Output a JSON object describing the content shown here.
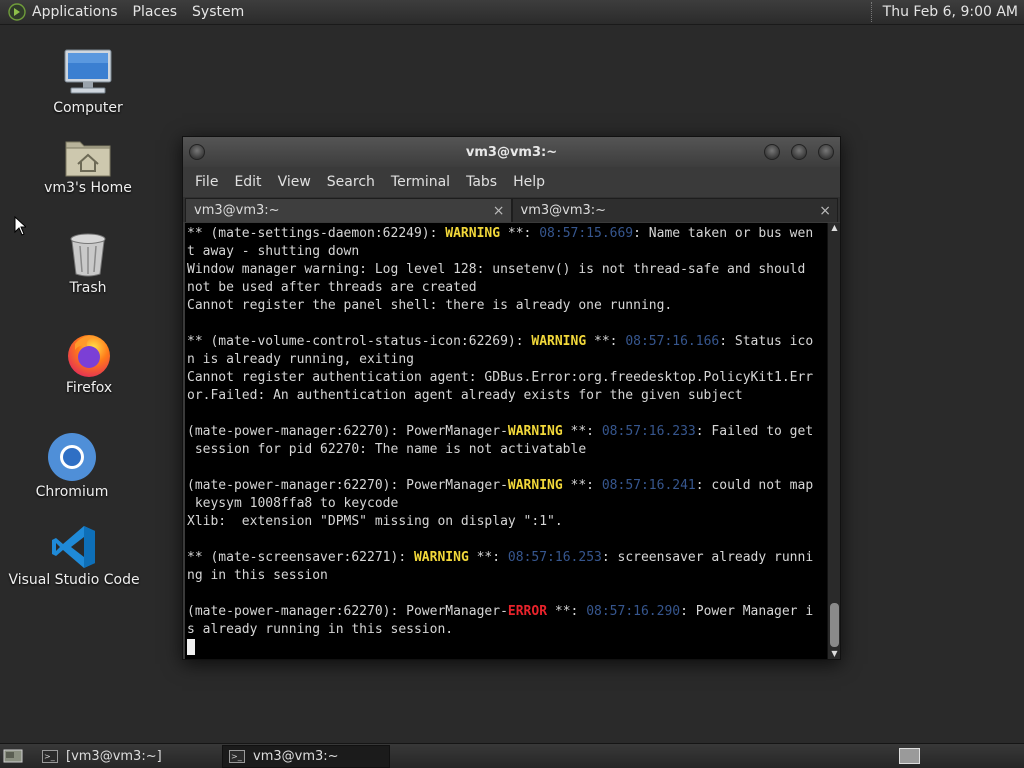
{
  "top_panel": {
    "menus": [
      "Applications",
      "Places",
      "System"
    ],
    "clock": "Thu Feb  6,  9:00 AM"
  },
  "desktop": {
    "icons": [
      {
        "label": "Computer",
        "icon": "computer-icon"
      },
      {
        "label": "vm3's Home",
        "icon": "home-folder-icon"
      },
      {
        "label": "Trash",
        "icon": "trash-icon"
      },
      {
        "label": "Firefox",
        "icon": "firefox-icon"
      },
      {
        "label": "Chromium",
        "icon": "chromium-icon"
      },
      {
        "label": "Visual Studio Code",
        "icon": "vscode-icon"
      }
    ]
  },
  "window": {
    "title": "vm3@vm3:~",
    "menu": [
      "File",
      "Edit",
      "View",
      "Search",
      "Terminal",
      "Tabs",
      "Help"
    ],
    "tabs": [
      {
        "label": "vm3@vm3:~",
        "active": true
      },
      {
        "label": "vm3@vm3:~",
        "active": false
      }
    ],
    "tab_close": "×"
  },
  "terminal": {
    "lines": [
      [
        {
          "t": "** (mate-settings-daemon:62249): "
        },
        {
          "t": "WARNING",
          "c": "warn"
        },
        {
          "t": " **: "
        },
        {
          "t": "08:57:15.669",
          "c": "ts"
        },
        {
          "t": ": Name taken or bus wen"
        }
      ],
      [
        {
          "t": "t away - shutting down"
        }
      ],
      [
        {
          "t": "Window manager warning: Log level 128: unsetenv() is not thread-safe and should"
        }
      ],
      [
        {
          "t": "not be used after threads are created"
        }
      ],
      [
        {
          "t": "Cannot register the panel shell: there is already one running."
        }
      ],
      [],
      [
        {
          "t": "** (mate-volume-control-status-icon:62269): "
        },
        {
          "t": "WARNING",
          "c": "warn"
        },
        {
          "t": " **: "
        },
        {
          "t": "08:57:16.166",
          "c": "ts"
        },
        {
          "t": ": Status ico"
        }
      ],
      [
        {
          "t": "n is already running, exiting"
        }
      ],
      [
        {
          "t": "Cannot register authentication agent: GDBus.Error:org.freedesktop.PolicyKit1.Err"
        }
      ],
      [
        {
          "t": "or.Failed: An authentication agent already exists for the given subject"
        }
      ],
      [],
      [
        {
          "t": "(mate-power-manager:62270): PowerManager-"
        },
        {
          "t": "WARNING",
          "c": "warn"
        },
        {
          "t": " **: "
        },
        {
          "t": "08:57:16.233",
          "c": "ts"
        },
        {
          "t": ": Failed to get"
        }
      ],
      [
        {
          "t": " session for pid 62270: The name is not activatable"
        }
      ],
      [],
      [
        {
          "t": "(mate-power-manager:62270): PowerManager-"
        },
        {
          "t": "WARNING",
          "c": "warn"
        },
        {
          "t": " **: "
        },
        {
          "t": "08:57:16.241",
          "c": "ts"
        },
        {
          "t": ": could not map"
        }
      ],
      [
        {
          "t": " keysym 1008ffa8 to keycode"
        }
      ],
      [
        {
          "t": "Xlib:  extension \"DPMS\" missing on display \":1\"."
        }
      ],
      [],
      [
        {
          "t": "** (mate-screensaver:62271): "
        },
        {
          "t": "WARNING",
          "c": "warn"
        },
        {
          "t": " **: "
        },
        {
          "t": "08:57:16.253",
          "c": "ts"
        },
        {
          "t": ": screensaver already runni"
        }
      ],
      [
        {
          "t": "ng in this session"
        }
      ],
      [],
      [
        {
          "t": "(mate-power-manager:62270): PowerManager-"
        },
        {
          "t": "ERROR",
          "c": "err"
        },
        {
          "t": " **: "
        },
        {
          "t": "08:57:16.290",
          "c": "ts"
        },
        {
          "t": ": Power Manager i"
        }
      ],
      [
        {
          "t": "s already running in this session."
        }
      ]
    ]
  },
  "taskbar": {
    "items": [
      {
        "label": "[vm3@vm3:~]",
        "minimized": true
      },
      {
        "label": "vm3@vm3:~",
        "minimized": false
      }
    ]
  },
  "colors": {
    "warning": "#f2d83a",
    "error": "#e8232b",
    "timestamp": "#36568e",
    "terminal_bg": "#000000"
  }
}
